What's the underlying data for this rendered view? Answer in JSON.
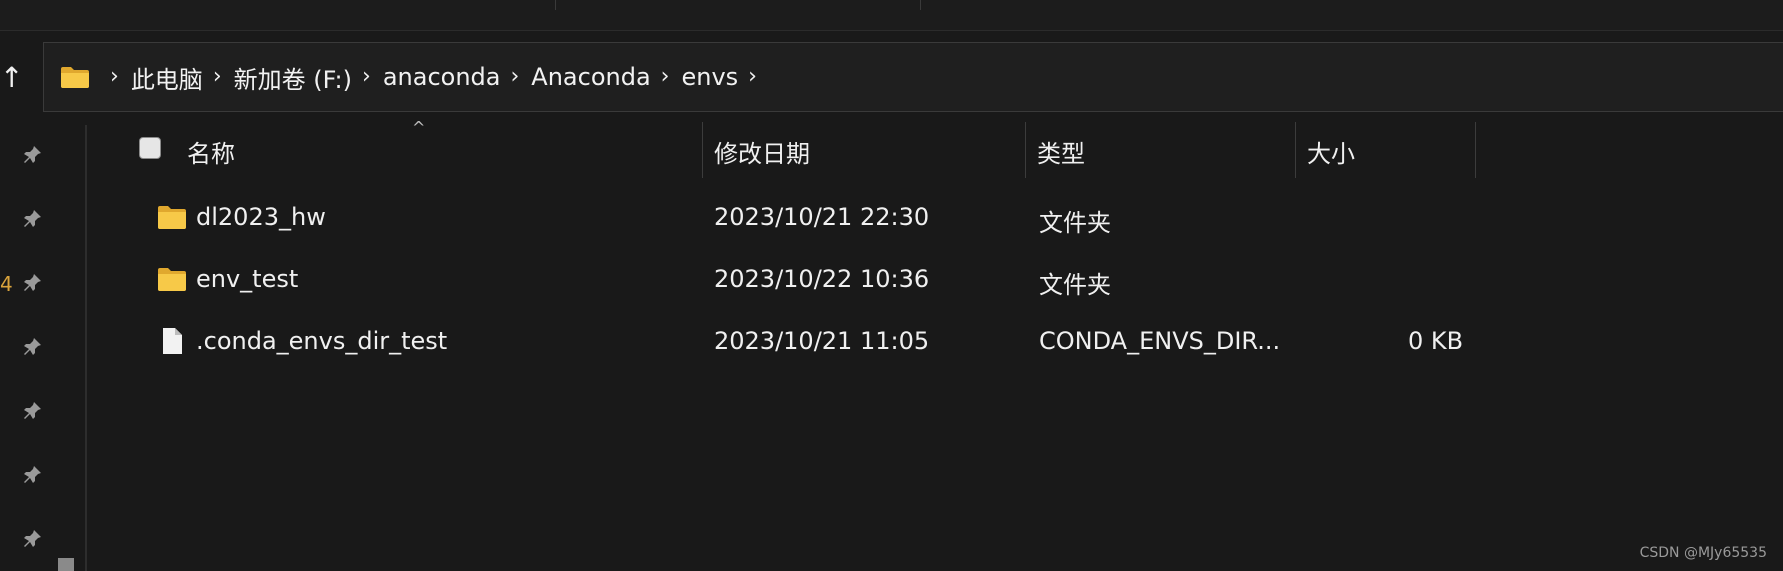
{
  "window": {
    "up_glyph": "↑"
  },
  "address_bar": {
    "breadcrumbs": [
      "此电脑",
      "新加卷 (F:)",
      "anaconda",
      "Anaconda",
      "envs"
    ],
    "chevron": "›",
    "folder_icon": "folder-icon"
  },
  "left_rail": {
    "pin_icons": 7,
    "partial_glyph": "4"
  },
  "file_list": {
    "sort_indicator": "^",
    "columns": {
      "name": "名称",
      "modified": "修改日期",
      "type": "类型",
      "size": "大小"
    },
    "rows": [
      {
        "icon": "folder-icon",
        "name": "dl2023_hw",
        "modified": "2023/10/21 22:30",
        "type": "文件夹",
        "size": ""
      },
      {
        "icon": "folder-icon",
        "name": "env_test",
        "modified": "2023/10/22 10:36",
        "type": "文件夹",
        "size": ""
      },
      {
        "icon": "file-icon",
        "name": ".conda_envs_dir_test",
        "modified": "2023/10/21 11:05",
        "type": "CONDA_ENVS_DIR...",
        "size": "0 KB"
      }
    ]
  },
  "watermark": "CSDN @MJy65535",
  "colors": {
    "background": "#191919",
    "folder_yellow": "#f4c542",
    "text": "#f0f0f0"
  }
}
